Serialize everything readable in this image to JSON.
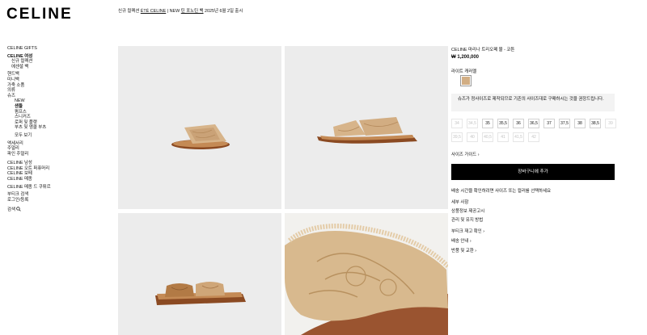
{
  "brand": {
    "logo": "CELINE"
  },
  "announcement": {
    "part1": "신규 컬렉션 ",
    "link1": "ÉTÉ CELINE",
    "part2": " | NEW ",
    "link2": "틴 포노틴 백",
    "part3": " 2025년 6월 2일 출시"
  },
  "nav": {
    "gifts": "CELINE GIFTS",
    "women": "CELINE 여성",
    "new_collection": "신규 컬렉션",
    "summer_shop": "에센셜 백",
    "handbags": "핸드백",
    "small_bags": "미니백",
    "leather_goods": "가죽 소품",
    "clothing": "의류",
    "shoes": "슈즈",
    "shoes_new": "NEW",
    "sandals": "샌들",
    "pumps": "펌프스",
    "sneakers": "스니커즈",
    "loafers": "로퍼 및 플랫",
    "boots": "부츠 및 앵클 부츠",
    "view_all": "모두 보기",
    "accessories": "액세서리",
    "jewelry": "주얼리",
    "fine_jewelry": "파인 주얼리",
    "men": "CELINE 남성",
    "haute_parfumerie": "CELINE 오트 퍼퓨머리",
    "art": "CELINE 보떼",
    "maison": "CELINE 메종",
    "world": "CELINE 메종 드 쿠튀르",
    "store_locator": "부티크 검색",
    "login": "로그인/등록",
    "search": "검색"
  },
  "product": {
    "name": "CELINE 마리나 트리오페 뮬 - 코튼",
    "price": "₩ 1,200,000",
    "color_label": "라이트 캐러멜",
    "swatch_color": "#d2ae84",
    "notice": "슈즈가 정사이즈로 제작되므로 기존의 사이즈대로 구매하시는 것을 권장드립니다.",
    "sizes_row1": [
      {
        "label": "34",
        "available": false
      },
      {
        "label": "34,5",
        "available": false
      },
      {
        "label": "35",
        "available": true
      },
      {
        "label": "35,5",
        "available": true
      },
      {
        "label": "36",
        "available": true
      },
      {
        "label": "36,5",
        "available": true
      },
      {
        "label": "37",
        "available": true
      },
      {
        "label": "37,5",
        "available": true
      },
      {
        "label": "38",
        "available": true
      },
      {
        "label": "38,5",
        "available": true
      },
      {
        "label": "39",
        "available": false
      }
    ],
    "sizes_row2": [
      {
        "label": "39,5",
        "available": false
      },
      {
        "label": "40",
        "available": false
      },
      {
        "label": "40,5",
        "available": false
      },
      {
        "label": "41",
        "available": false
      },
      {
        "label": "41,5",
        "available": false
      },
      {
        "label": "42",
        "available": false
      }
    ],
    "size_guide": "사이즈 가이드",
    "add_to_cart": "장바구니에 추가",
    "shipping_text": "배송 시간을 확인하려면 사이즈 또는 컬러를 선택하세요",
    "details": "세부 사항",
    "product_info": "상품정보 제공고시",
    "care": "관리 및 유지 방법",
    "store_stock": "부티크 재고 확인",
    "delivery": "배송 안내",
    "returns": "반품 및 교환"
  },
  "colors": {
    "tile_bg": "#ececec",
    "tan": "#d2ae84",
    "sole": "#8b4a22",
    "cta_bg": "#000000"
  }
}
